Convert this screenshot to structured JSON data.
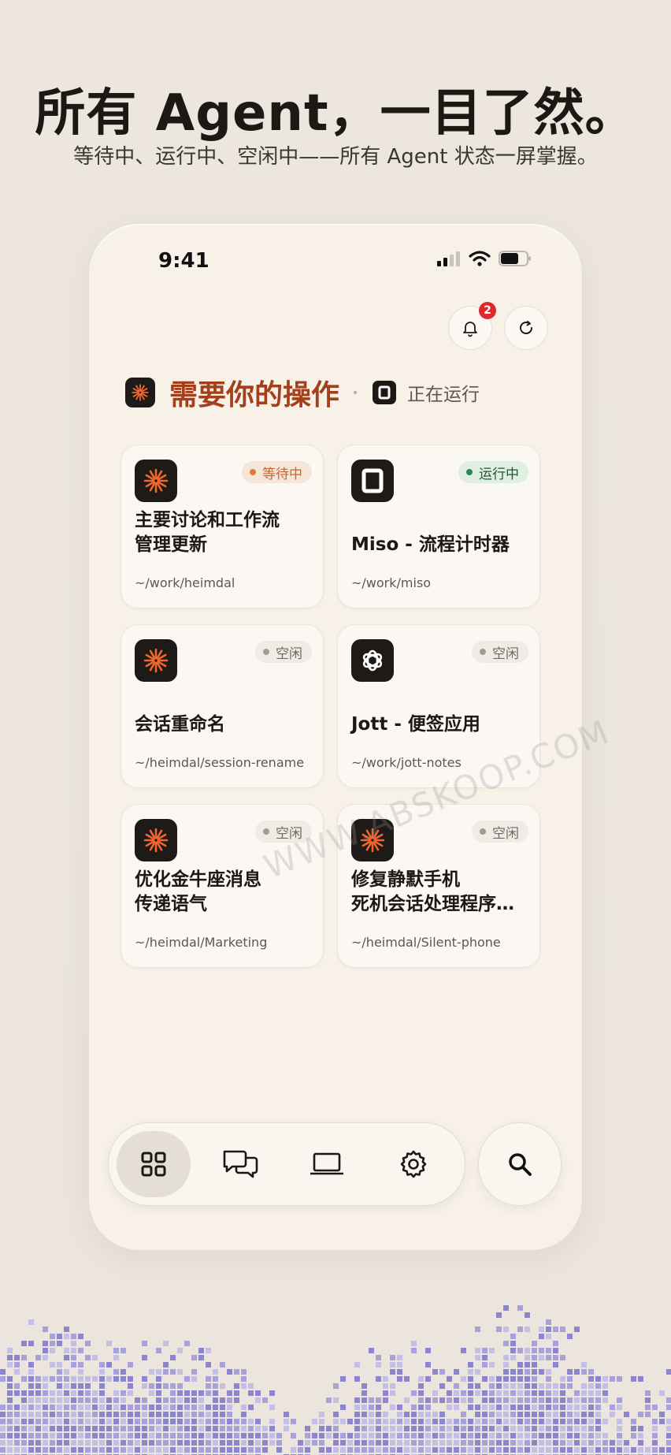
{
  "header": {
    "title": "所有 Agent，一目了然。",
    "subtitle": "等待中、运行中、空闲中——所有 Agent 状态一屏掌握。"
  },
  "status_bar": {
    "time": "9:41"
  },
  "notifications": {
    "count": "2"
  },
  "tabs": {
    "active": "需要你的操作",
    "inactive": "正在运行"
  },
  "cards": [
    {
      "icon": "sunburst-icon",
      "status": "等待中",
      "status_type": "waiting",
      "title": "主要讨论和工作流\n管理更新",
      "path": "~/work/heimdal"
    },
    {
      "icon": "box-icon",
      "status": "运行中",
      "status_type": "running",
      "title": "Miso - 流程计时器",
      "path": "~/work/miso"
    },
    {
      "icon": "sunburst-icon",
      "status": "空闲",
      "status_type": "idle",
      "title": "会话重命名",
      "path": "~/heimdal/session-rename"
    },
    {
      "icon": "openai-knot-icon",
      "status": "空闲",
      "status_type": "idle",
      "title": "Jott - 便签应用",
      "path": "~/work/jott-notes"
    },
    {
      "icon": "sunburst-icon",
      "status": "空闲",
      "status_type": "idle",
      "title": "优化金牛座消息\n传递语气",
      "path": "~/heimdal/Marketing"
    },
    {
      "icon": "sunburst-icon",
      "status": "空闲",
      "status_type": "idle",
      "title": "修复静默手机\n死机会话处理程序…",
      "path": "~/heimdal/Silent-phone"
    }
  ],
  "bottom_nav": [
    "grid-icon",
    "chat-icon",
    "laptop-icon",
    "settings-icon"
  ],
  "watermark": "WWW.ABSKOOP.COM",
  "colors": {
    "accent": "#a3401c",
    "sunburst": "#f0662e",
    "waiting": "#dd7a3a",
    "running": "#2c8a55",
    "badge": "#e0262e",
    "pixel_band": "#8c86cf"
  }
}
